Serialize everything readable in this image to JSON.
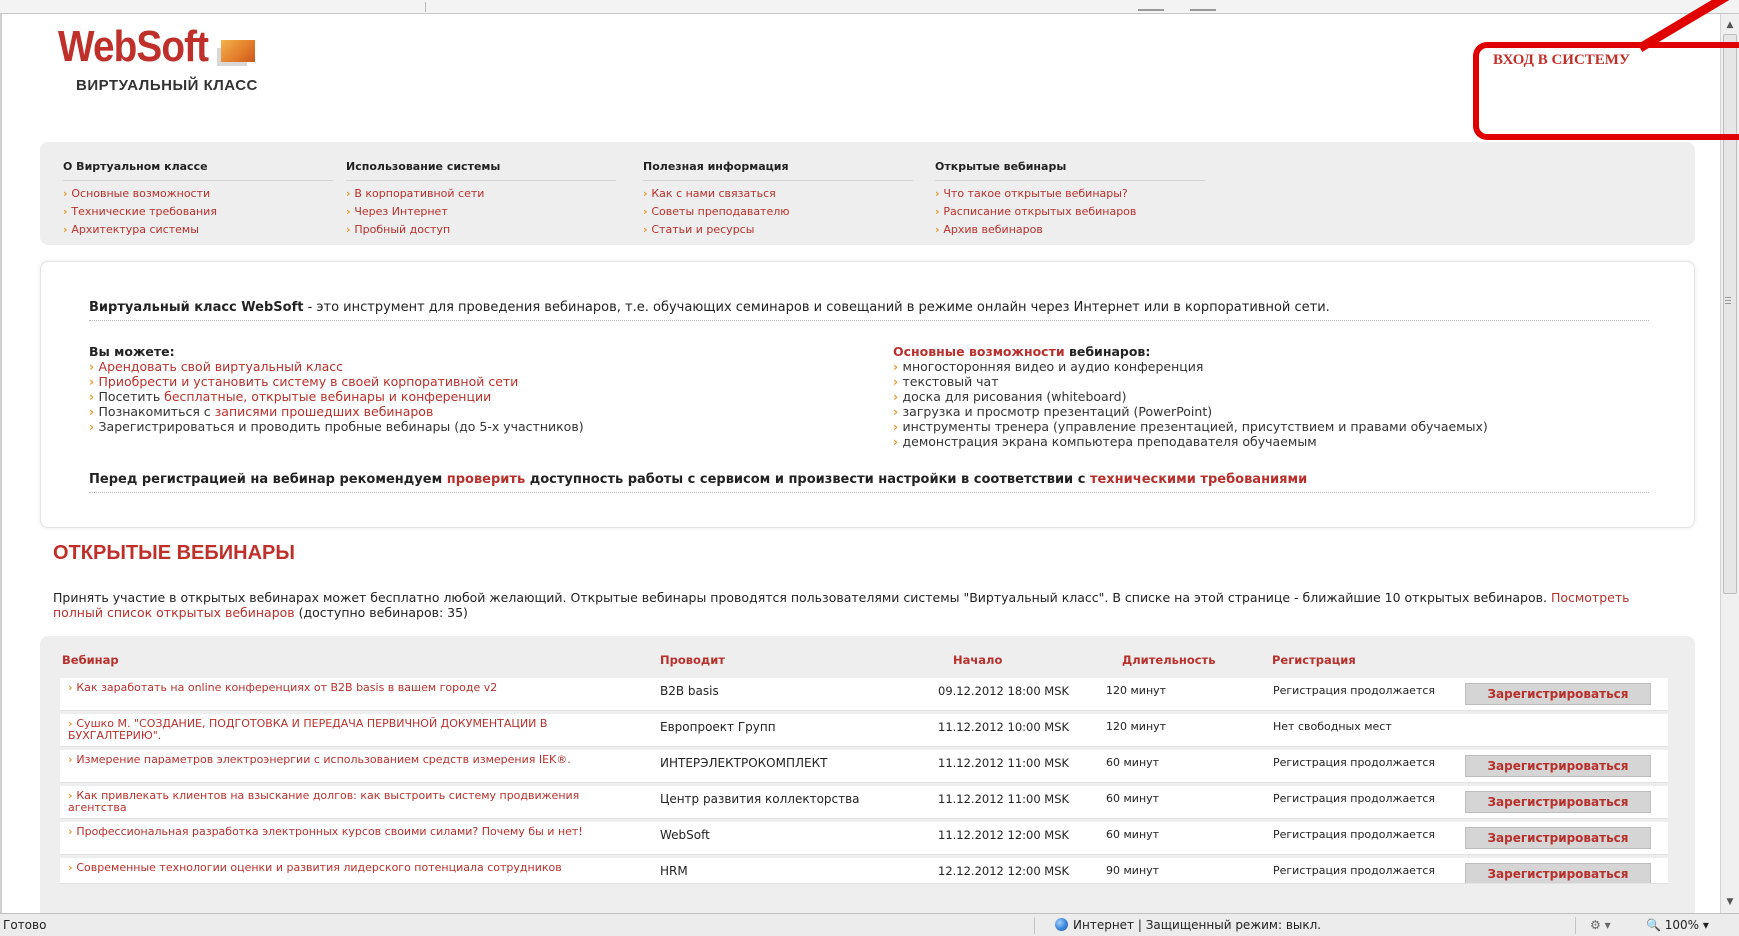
{
  "header": {
    "logo_brand": "WebSoft",
    "logo_sub": "ВИРТУАЛЬНЫЙ КЛАСС",
    "login": "ВХОД В СИСТЕМУ"
  },
  "nav": [
    {
      "title": "О Виртуальном классе",
      "items": [
        "Основные возможности",
        "Технические требования",
        "Архитектура системы"
      ]
    },
    {
      "title": "Использование системы",
      "items": [
        "В корпоративной сети",
        "Через Интернет",
        "Пробный доступ"
      ]
    },
    {
      "title": "Полезная информация",
      "items": [
        "Как с нами связаться",
        "Советы преподавателю",
        "Статьи и ресурсы"
      ]
    },
    {
      "title": "Открытые вебинары",
      "items": [
        "Что такое открытые вебинары?",
        "Расписание открытых вебинаров",
        "Архив вебинаров"
      ]
    }
  ],
  "info": {
    "intro_bold": "Виртуальный класс WebSoft",
    "intro_rest": " - это инструмент для проведения вебинаров, т.е. обучающих семинаров и совещаний в режиме онлайн через Интернет или в корпоративной сети.",
    "you_can": "Вы можете:",
    "you_can_items": [
      {
        "pre": "",
        "link": "Арендовать свой виртуальный класс",
        "post": ""
      },
      {
        "pre": "",
        "link": "Приобрести и установить систему в своей корпоративной сети",
        "post": ""
      },
      {
        "pre": "Посетить ",
        "link": "бесплатные, открытые вебинары и конференции",
        "post": ""
      },
      {
        "pre": "Познакомиться с ",
        "link": "записями прошедших вебинаров",
        "post": ""
      },
      {
        "pre": "Зарегистрироваться и проводить пробные вебинары (до 5-х участников)",
        "link": "",
        "post": ""
      }
    ],
    "features_link": "Основные возможности",
    "features_rest": " вебинаров:",
    "features": [
      "многосторонняя видео и аудио конференция",
      "текстовый чат",
      "доска для рисования (whiteboard)",
      "загрузка и просмотр презентаций (PowerPoint)",
      "инструменты тренера (управление презентацией, присутствием и правами обучаемых)",
      "демонстрация экрана компьютера преподавателя обучаемым"
    ],
    "note_pre": "Перед регистрацией на вебинар рекомендуем ",
    "note_link1": "проверить",
    "note_mid": " доступность работы с сервисом и произвести настройки в соответствии с ",
    "note_link2": "техническими требованиями"
  },
  "open_webinars": {
    "title": "ОТКРЫТЫЕ ВЕБИНАРЫ",
    "desc_1": "Принять участие в открытых вебинарах может бесплатно любой желающий. Открытые вебинары проводятся пользователями системы \"Виртуальный класс\". В списке на этой странице - ближайшие 10 открытых вебинаров. ",
    "desc_link": "Посмотреть полный список открытых вебинаров",
    "desc_2": " (доступно вебинаров: 35)",
    "columns": [
      "Вебинар",
      "Проводит",
      "Начало",
      "Длительность",
      "Регистрация"
    ],
    "button_label": "Зарегистрироваться",
    "rows": [
      {
        "title": "Как заработать на online конференциях от B2B basis в вашем городе v2",
        "host": "B2B basis",
        "start": "09.12.2012 18:00 MSK",
        "duration": "120 минут",
        "status": "Регистрация продолжается",
        "button": true
      },
      {
        "title": "Сушко М. \"СОЗДАНИЕ, ПОДГОТОВКА И ПЕРЕДАЧА ПЕРВИЧНОЙ ДОКУМЕНТАЦИИ В БУХГАЛТЕРИЮ\".",
        "host": "Европроект Групп",
        "start": "11.12.2012 10:00 MSK",
        "duration": "120 минут",
        "status": "Нет свободных мест",
        "button": false
      },
      {
        "title": "Измерение параметров электроэнергии с использованием средств измерения IEK®.",
        "host": "ИНТЕРЭЛЕКТРОКОМПЛЕКТ",
        "start": "11.12.2012 11:00 MSK",
        "duration": "60 минут",
        "status": "Регистрация продолжается",
        "button": true
      },
      {
        "title": "Как привлекать клиентов на взыскание долгов: как выстроить систему продвижения агентства",
        "host": "Центр развития коллекторства",
        "start": "11.12.2012 11:00 MSK",
        "duration": "60 минут",
        "status": "Регистрация продолжается",
        "button": true
      },
      {
        "title": "Профессиональная разработка электронных курсов своими силами? Почему бы и нет!",
        "host": "WebSoft",
        "start": "11.12.2012 12:00 MSK",
        "duration": "60 минут",
        "status": "Регистрация продолжается",
        "button": true
      },
      {
        "title": "Современные технологии оценки и развития лидерского потенциала сотрудников",
        "host": "HRM",
        "start": "12.12.2012 12:00 MSK",
        "duration": "90 минут",
        "status": "Регистрация продолжается",
        "button": true
      }
    ]
  },
  "statusbar": {
    "ready": "Готово",
    "zone": "Интернет | Защищенный режим: выкл.",
    "zoom": "100%"
  },
  "colors": {
    "accent": "#b8302c",
    "annotation": "#e00000",
    "bullet": "#e69a2b"
  }
}
